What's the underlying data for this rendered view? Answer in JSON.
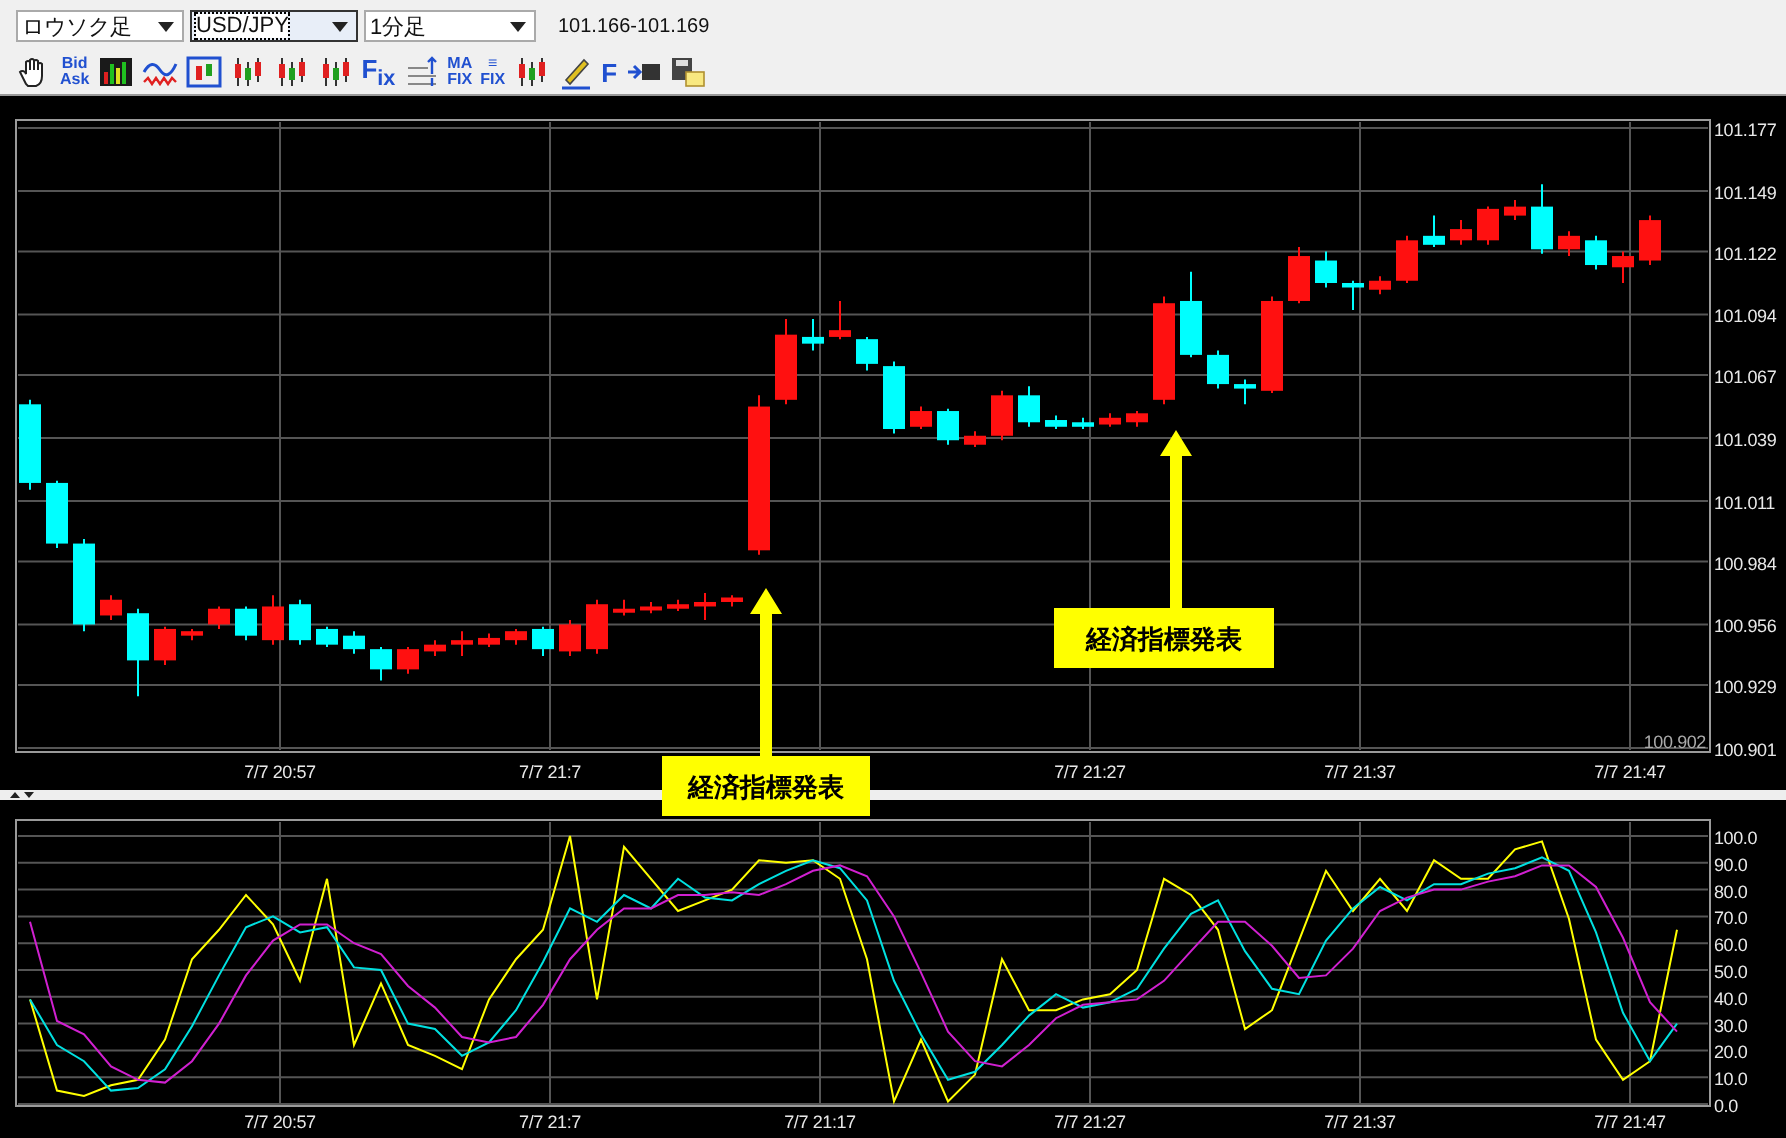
{
  "toolbar": {
    "dropdowns": [
      {
        "value": "ロウソク足",
        "focused": false
      },
      {
        "value": "USD/JPY",
        "focused": true
      },
      {
        "value": "1分足",
        "focused": false
      }
    ],
    "quote": "101.166-101.169",
    "buttons": [
      {
        "kind": "hand"
      },
      {
        "kind": "stack",
        "lines": [
          "Bid",
          "Ask"
        ]
      },
      {
        "kind": "meter"
      },
      {
        "kind": "wave"
      },
      {
        "kind": "frame"
      },
      {
        "kind": "candles"
      },
      {
        "kind": "candles"
      },
      {
        "kind": "candles"
      },
      {
        "kind": "text",
        "label": "F$_{ix}$"
      },
      {
        "kind": "grid"
      },
      {
        "kind": "stack",
        "lines": [
          "MA",
          "FIX"
        ]
      },
      {
        "kind": "stack",
        "lines": [
          "≡",
          "FIX"
        ]
      },
      {
        "kind": "candles"
      },
      {
        "kind": "pencil"
      },
      {
        "kind": "text",
        "label": "F"
      },
      {
        "kind": "arrowbox"
      },
      {
        "kind": "note"
      }
    ]
  },
  "price_chart": {
    "time_labels_left": [
      "7/7 20:57",
      "7/7 21:7"
    ],
    "time_labels_right": [
      "7/7 21:27",
      "7/7 21:37",
      "7/7 21:47"
    ],
    "last_label": "100.902",
    "chart_data": {
      "type": "candlestick",
      "grid": true,
      "ylim": [
        100.901,
        101.177
      ],
      "yticks": [
        {
          "value": 101.177,
          "label": "101.177"
        },
        {
          "value": 101.149,
          "label": "101.149"
        },
        {
          "value": 101.122,
          "label": "101.122"
        },
        {
          "value": 101.094,
          "label": "101.094"
        },
        {
          "value": 101.067,
          "label": "101.067"
        },
        {
          "value": 101.039,
          "label": "101.039"
        },
        {
          "value": 101.011,
          "label": "101.011"
        },
        {
          "value": 100.984,
          "label": "100.984"
        },
        {
          "value": 100.956,
          "label": "100.956"
        },
        {
          "value": 100.929,
          "label": "100.929"
        },
        {
          "value": 100.901,
          "label": "100.901"
        }
      ],
      "annotations": [
        {
          "text": "経済指標発表"
        },
        {
          "text": "経済指標発表"
        }
      ],
      "ohlc": [
        [
          101.054,
          101.056,
          101.016,
          101.019
        ],
        [
          101.019,
          101.02,
          100.99,
          100.992
        ],
        [
          100.992,
          100.994,
          100.953,
          100.956
        ],
        [
          100.96,
          100.969,
          100.958,
          100.967
        ],
        [
          100.961,
          100.963,
          100.924,
          100.94
        ],
        [
          100.94,
          100.955,
          100.938,
          100.954
        ],
        [
          100.951,
          100.954,
          100.949,
          100.953
        ],
        [
          100.956,
          100.964,
          100.954,
          100.963
        ],
        [
          100.963,
          100.964,
          100.949,
          100.951
        ],
        [
          100.949,
          100.969,
          100.947,
          100.964
        ],
        [
          100.965,
          100.967,
          100.947,
          100.949
        ],
        [
          100.954,
          100.955,
          100.946,
          100.947
        ],
        [
          100.951,
          100.953,
          100.943,
          100.945
        ],
        [
          100.945,
          100.946,
          100.931,
          100.936
        ],
        [
          100.936,
          100.946,
          100.934,
          100.945
        ],
        [
          100.944,
          100.949,
          100.942,
          100.947
        ],
        [
          100.947,
          100.953,
          100.942,
          100.949
        ],
        [
          100.947,
          100.952,
          100.946,
          100.95
        ],
        [
          100.949,
          100.954,
          100.947,
          100.953
        ],
        [
          100.954,
          100.955,
          100.942,
          100.945
        ],
        [
          100.944,
          100.958,
          100.942,
          100.956
        ],
        [
          100.945,
          100.967,
          100.943,
          100.965
        ],
        [
          100.962,
          100.967,
          100.96,
          100.963
        ],
        [
          100.963,
          100.966,
          100.961,
          100.964
        ],
        [
          100.963,
          100.967,
          100.962,
          100.965
        ],
        [
          100.964,
          100.97,
          100.958,
          100.966
        ],
        [
          100.966,
          100.969,
          100.964,
          100.968
        ],
        [
          100.989,
          101.058,
          100.987,
          101.053
        ],
        [
          101.056,
          101.092,
          101.054,
          101.085
        ],
        [
          101.084,
          101.092,
          101.078,
          101.081
        ],
        [
          101.084,
          101.1,
          101.083,
          101.087
        ],
        [
          101.083,
          101.084,
          101.069,
          101.072
        ],
        [
          101.071,
          101.073,
          101.041,
          101.043
        ],
        [
          101.044,
          101.053,
          101.043,
          101.051
        ],
        [
          101.051,
          101.052,
          101.036,
          101.038
        ],
        [
          101.036,
          101.042,
          101.035,
          101.04
        ],
        [
          101.04,
          101.06,
          101.038,
          101.058
        ],
        [
          101.058,
          101.062,
          101.044,
          101.046
        ],
        [
          101.047,
          101.049,
          101.043,
          101.044
        ],
        [
          101.046,
          101.048,
          101.043,
          101.044
        ],
        [
          101.045,
          101.05,
          101.044,
          101.048
        ],
        [
          101.046,
          101.051,
          101.044,
          101.05
        ],
        [
          101.056,
          101.102,
          101.054,
          101.099
        ],
        [
          101.1,
          101.113,
          101.075,
          101.076
        ],
        [
          101.076,
          101.078,
          101.061,
          101.063
        ],
        [
          101.063,
          101.065,
          101.054,
          101.061
        ],
        [
          101.06,
          101.102,
          101.059,
          101.1
        ],
        [
          101.1,
          101.124,
          101.099,
          101.12
        ],
        [
          101.118,
          101.122,
          101.106,
          101.108
        ],
        [
          101.108,
          101.109,
          101.096,
          101.106
        ],
        [
          101.105,
          101.111,
          101.103,
          101.109
        ],
        [
          101.109,
          101.129,
          101.108,
          101.127
        ],
        [
          101.129,
          101.138,
          101.124,
          101.125
        ],
        [
          101.127,
          101.136,
          101.125,
          101.132
        ],
        [
          101.127,
          101.142,
          101.125,
          101.141
        ],
        [
          101.138,
          101.145,
          101.136,
          101.142
        ],
        [
          101.142,
          101.152,
          101.121,
          101.123
        ],
        [
          101.123,
          101.131,
          101.12,
          101.129
        ],
        [
          101.127,
          101.129,
          101.114,
          101.116
        ],
        [
          101.115,
          101.122,
          101.108,
          101.12
        ],
        [
          101.118,
          101.138,
          101.116,
          101.136
        ]
      ]
    }
  },
  "oscillator": {
    "time_labels": [
      "7/7 20:57",
      "7/7 21:7",
      "7/7 21:17",
      "7/7 21:27",
      "7/7 21:37",
      "7/7 21:47"
    ],
    "chart_data": {
      "type": "line",
      "grid": true,
      "ylim": [
        0,
        100
      ],
      "yticks": [
        {
          "value": 100,
          "label": "100.0"
        },
        {
          "value": 90,
          "label": "90.0"
        },
        {
          "value": 80,
          "label": "80.0"
        },
        {
          "value": 70,
          "label": "70.0"
        },
        {
          "value": 60,
          "label": "60.0"
        },
        {
          "value": 50,
          "label": "50.0"
        },
        {
          "value": 40,
          "label": "40.0"
        },
        {
          "value": 30,
          "label": "30.0"
        },
        {
          "value": 20,
          "label": "20.0"
        },
        {
          "value": 10,
          "label": "10.0"
        },
        {
          "value": 0,
          "label": "0.0"
        }
      ],
      "series": [
        {
          "color": "#ffff00",
          "values": [
            39,
            5,
            3,
            7,
            9,
            24,
            54,
            65,
            78,
            67,
            46,
            84,
            22,
            45,
            22,
            18,
            13,
            39,
            54,
            65,
            100,
            39,
            96,
            84,
            72,
            76,
            80,
            91,
            90,
            91,
            84,
            54,
            1,
            24,
            1,
            11,
            54,
            35,
            35,
            39,
            41,
            50,
            84,
            78,
            65,
            28,
            35,
            61,
            87,
            72,
            84,
            72,
            91,
            84,
            84,
            95,
            98,
            69,
            24,
            9,
            16,
            65
          ]
        },
        {
          "color": "#00e0e0",
          "values": [
            39,
            22,
            16,
            5,
            6,
            13,
            29,
            48,
            66,
            70,
            64,
            66,
            51,
            50,
            30,
            28,
            18,
            23,
            35,
            53,
            73,
            68,
            78,
            73,
            84,
            77,
            76,
            82,
            87,
            91,
            88,
            76,
            46,
            26,
            9,
            12,
            22,
            33,
            41,
            36,
            38,
            43,
            58,
            71,
            76,
            57,
            43,
            41,
            61,
            73,
            81,
            76,
            82,
            82,
            86,
            88,
            92,
            87,
            64,
            34,
            16,
            30
          ]
        },
        {
          "color": "#d020d0",
          "values": [
            68,
            31,
            26,
            14,
            9,
            8,
            16,
            30,
            48,
            61,
            67,
            67,
            60,
            56,
            44,
            36,
            25,
            23,
            25,
            37,
            54,
            65,
            73,
            73,
            78,
            78,
            79,
            78,
            82,
            87,
            89,
            85,
            70,
            49,
            27,
            16,
            14,
            22,
            32,
            37,
            38,
            39,
            46,
            57,
            68,
            68,
            59,
            47,
            48,
            58,
            72,
            77,
            80,
            80,
            83,
            85,
            89,
            89,
            81,
            62,
            38,
            27
          ]
        }
      ]
    }
  }
}
